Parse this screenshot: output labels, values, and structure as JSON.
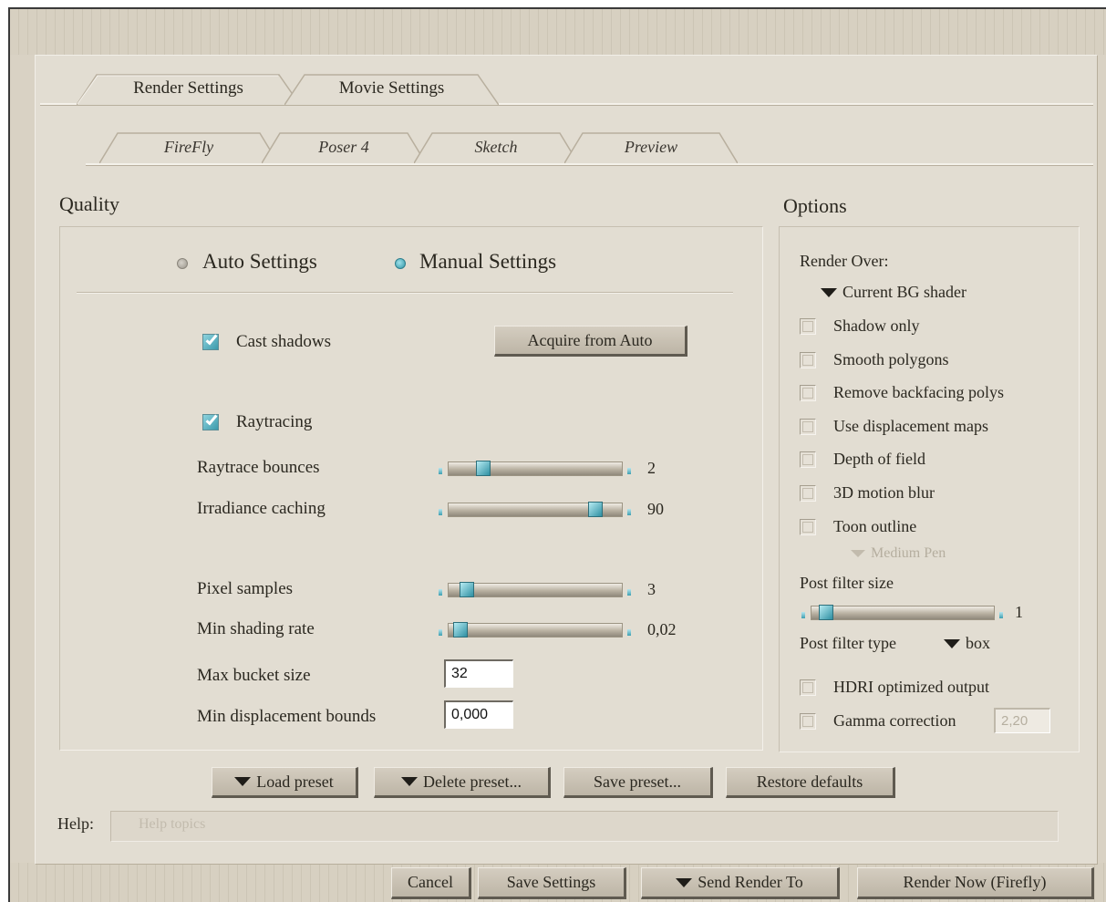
{
  "tabs_top": [
    {
      "label": "Render Settings",
      "active": true
    },
    {
      "label": "Movie Settings",
      "active": false
    }
  ],
  "tabs_engine": [
    {
      "label": "FireFly",
      "active": true
    },
    {
      "label": "Poser 4",
      "active": false
    },
    {
      "label": "Sketch",
      "active": false
    },
    {
      "label": "Preview",
      "active": false
    }
  ],
  "quality": {
    "title": "Quality",
    "mode_auto": "Auto Settings",
    "mode_manual": "Manual Settings",
    "selected_mode": "manual",
    "cast_shadows": {
      "label": "Cast shadows",
      "checked": true
    },
    "acquire_button": "Acquire from Auto",
    "raytracing": {
      "label": "Raytracing",
      "checked": true
    },
    "sliders": [
      {
        "label": "Raytrace bounces",
        "value": "2",
        "fraction": 0.15
      },
      {
        "label": "Irradiance caching",
        "value": "90",
        "fraction": 0.9
      },
      {
        "label": "Pixel samples",
        "value": "3",
        "fraction": 0.04
      },
      {
        "label": "Min shading rate",
        "value": "0,02",
        "fraction": 0.0
      }
    ],
    "max_bucket": {
      "label": "Max bucket size",
      "value": "32"
    },
    "min_disp": {
      "label": "Min displacement bounds",
      "value": "0,000"
    }
  },
  "options": {
    "title": "Options",
    "render_over_label": "Render Over:",
    "render_over_value": "Current BG shader",
    "checkboxes": [
      {
        "label": "Shadow only",
        "checked": false
      },
      {
        "label": "Smooth polygons",
        "checked": false
      },
      {
        "label": "Remove backfacing polys",
        "checked": false
      },
      {
        "label": "Use displacement maps",
        "checked": false
      },
      {
        "label": "Depth of field",
        "checked": false
      },
      {
        "label": "3D motion blur",
        "checked": false
      },
      {
        "label": "Toon outline",
        "checked": false
      }
    ],
    "toon_style": "Medium Pen",
    "post_filter_size_label": "Post filter size",
    "post_filter_size_value": "1",
    "post_filter_size_fraction": 0.02,
    "post_filter_type_label": "Post filter type",
    "post_filter_type_value": "box",
    "hdri": {
      "label": "HDRI optimized output",
      "checked": false
    },
    "gamma": {
      "label": "Gamma correction",
      "checked": false,
      "value": "2,20"
    }
  },
  "preset_buttons": {
    "load": "Load preset",
    "delete": "Delete preset...",
    "save": "Save preset...",
    "restore": "Restore defaults"
  },
  "help": {
    "label": "Help:",
    "placeholder": "Help topics"
  },
  "footer_buttons": {
    "cancel": "Cancel",
    "save_settings": "Save Settings",
    "send_render": "Send Render To",
    "render_now": "Render Now (Firefly)"
  },
  "colors": {
    "accent": "#3b9aab",
    "background": "#e2ddd2"
  }
}
